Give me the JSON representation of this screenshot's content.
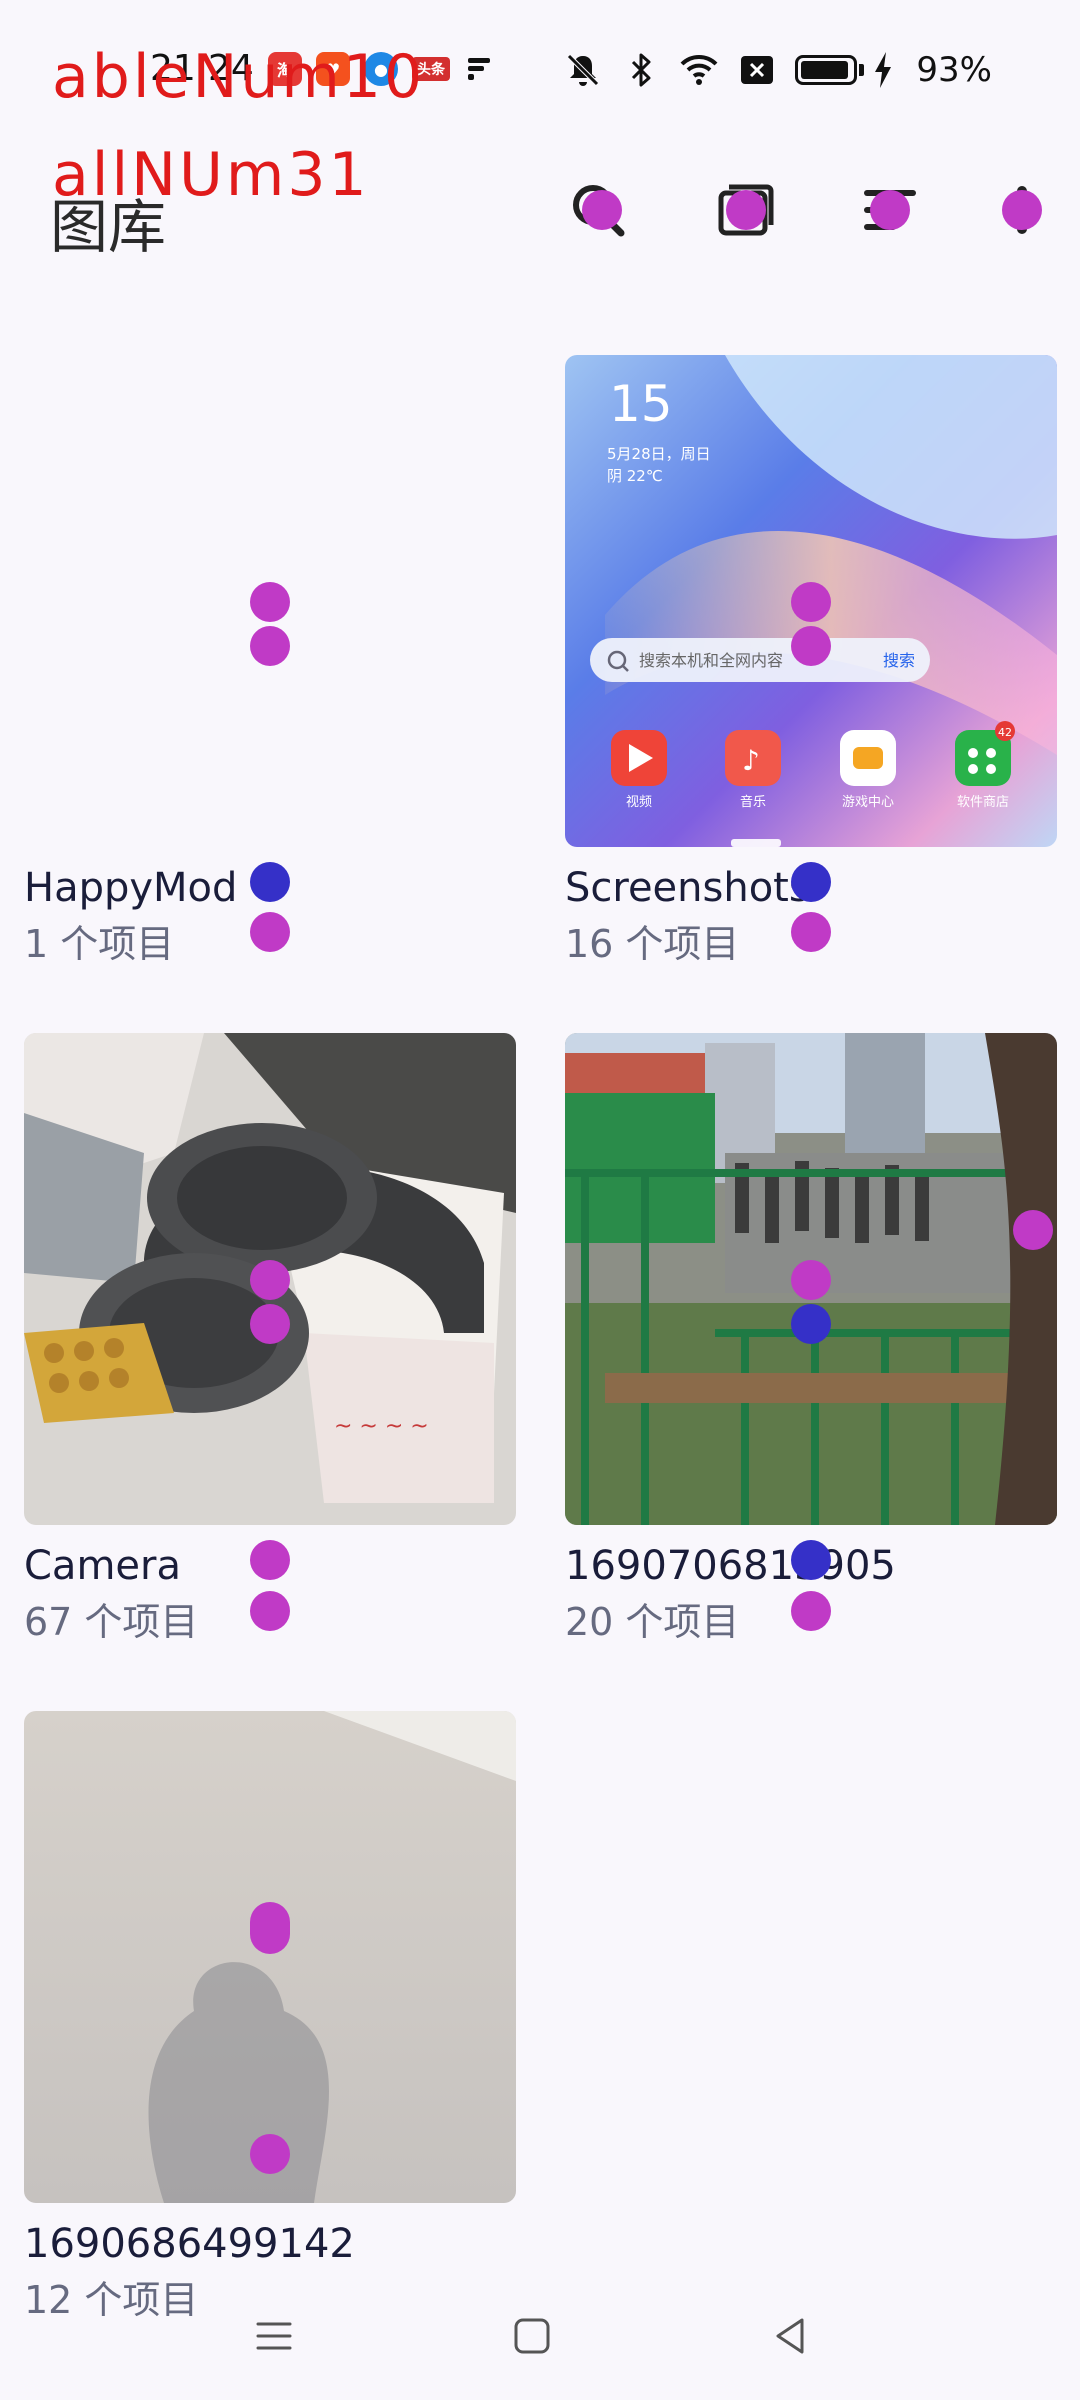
{
  "status_bar": {
    "time": "21:24",
    "notification_icons": [
      "taobao-icon",
      "app-icon",
      "browser-icon",
      "toutiao-icon",
      "flash-icon"
    ],
    "news_badge": "头条",
    "system_icons": [
      "mute-icon",
      "bluetooth-icon",
      "wifi-icon",
      "no-sim-icon",
      "battery-icon",
      "charging-icon"
    ],
    "battery_percent": "93%",
    "battery_level": 0.93
  },
  "debug_overlay": {
    "line1": "ableNum10",
    "line2": "allNUm31"
  },
  "header": {
    "title": "图库",
    "actions": [
      "search-icon",
      "photo-stack-icon",
      "sort-icon",
      "more-icon"
    ]
  },
  "albums": [
    {
      "name": "HappyMod",
      "count": "1 个项目"
    },
    {
      "name": "Screenshots",
      "count": "16 个项目"
    },
    {
      "name": "Camera",
      "count": "67 个项目"
    },
    {
      "name": "1690706815905",
      "count": "20 个项目"
    },
    {
      "name": "1690686499142",
      "count": "12 个项目"
    }
  ],
  "screenshot_thumb": {
    "clock": "15",
    "date": "5月28日，周日",
    "weather": "阴 22℃",
    "search_placeholder": "搜索本机和全网内容",
    "search_button": "搜索",
    "apps": [
      "视频",
      "音乐",
      "游戏中心",
      "软件商店"
    ],
    "store_badge": "42"
  },
  "nav_bar": [
    "menu-icon",
    "home-icon",
    "back-icon"
  ],
  "colors": {
    "background": "#f9f7fc",
    "overlay_text": "#e01b1b",
    "marker_magenta": "#c03ac6",
    "marker_blue": "#3530c8"
  }
}
